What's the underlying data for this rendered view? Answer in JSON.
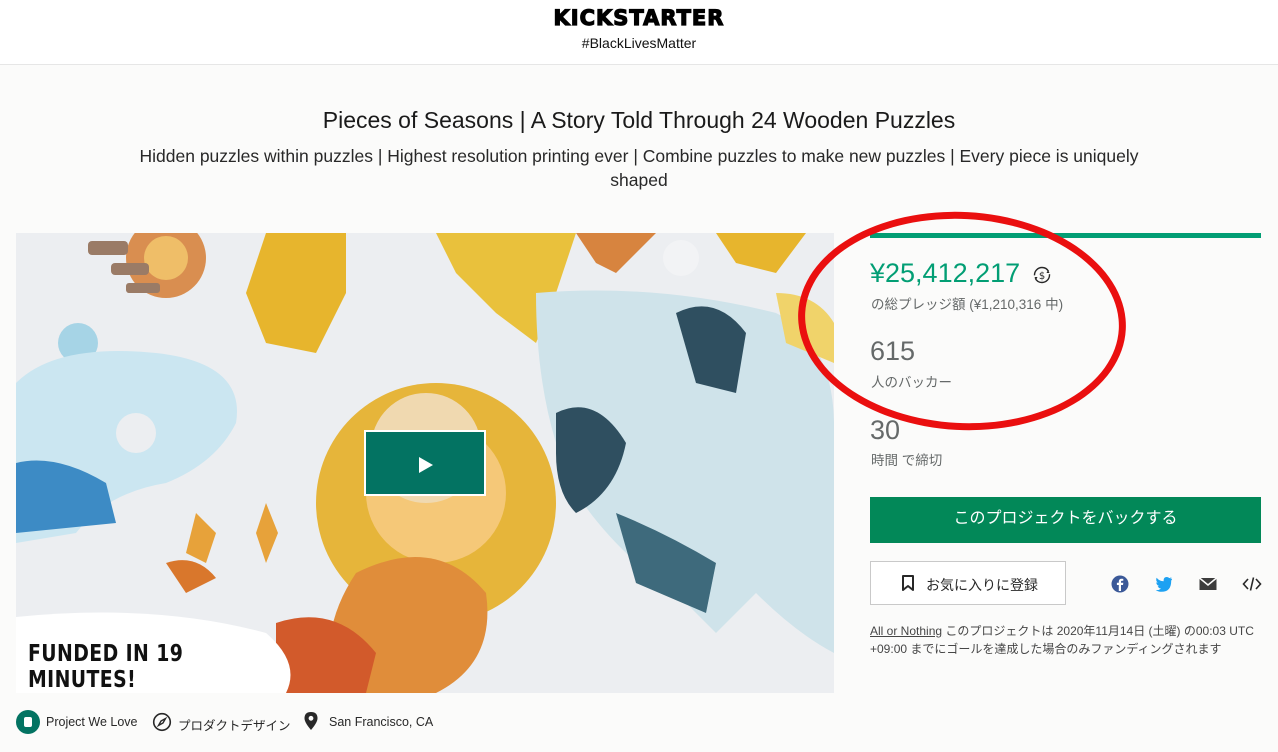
{
  "header": {
    "logo": "KICKSTARTER",
    "hashtag": "#BlackLivesMatter"
  },
  "project": {
    "title": "Pieces of Seasons | A Story Told Through 24 Wooden Puzzles",
    "subtitle": "Hidden puzzles within puzzles | Highest resolution printing ever | Combine puzzles to make new puzzles | Every piece is uniquely shaped"
  },
  "video": {
    "overlay_text": "FUNDED IN 19 MINUTES!",
    "play_icon": "play-icon"
  },
  "stats": {
    "pledged": "¥25,412,217",
    "pledged_label": "の総プレッジ額 (¥1,210,316 中)",
    "backers": "615",
    "backers_label": "人のバッカー",
    "time_left": "30",
    "time_label": "時間 で締切",
    "progress_percent": 100
  },
  "actions": {
    "back_label": "このプロジェクトをバックする",
    "remind_label": "お気に入りに登録",
    "share_icons": [
      "facebook-icon",
      "twitter-icon",
      "email-icon",
      "embed-icon"
    ]
  },
  "all_or_nothing": {
    "link": "All or Nothing",
    "text": " このプロジェクトは 2020年11月14日 (土曜) の00:03 UTC +09:00 までにゴールを達成した場合のみファンディングされます"
  },
  "meta": {
    "badge": "Project We Love",
    "category": "プロダクトデザイン",
    "location": "San Francisco, CA"
  },
  "colors": {
    "brand_green": "#028858",
    "accent_green": "#029e74",
    "annotation_red": "#ea0f0f"
  }
}
